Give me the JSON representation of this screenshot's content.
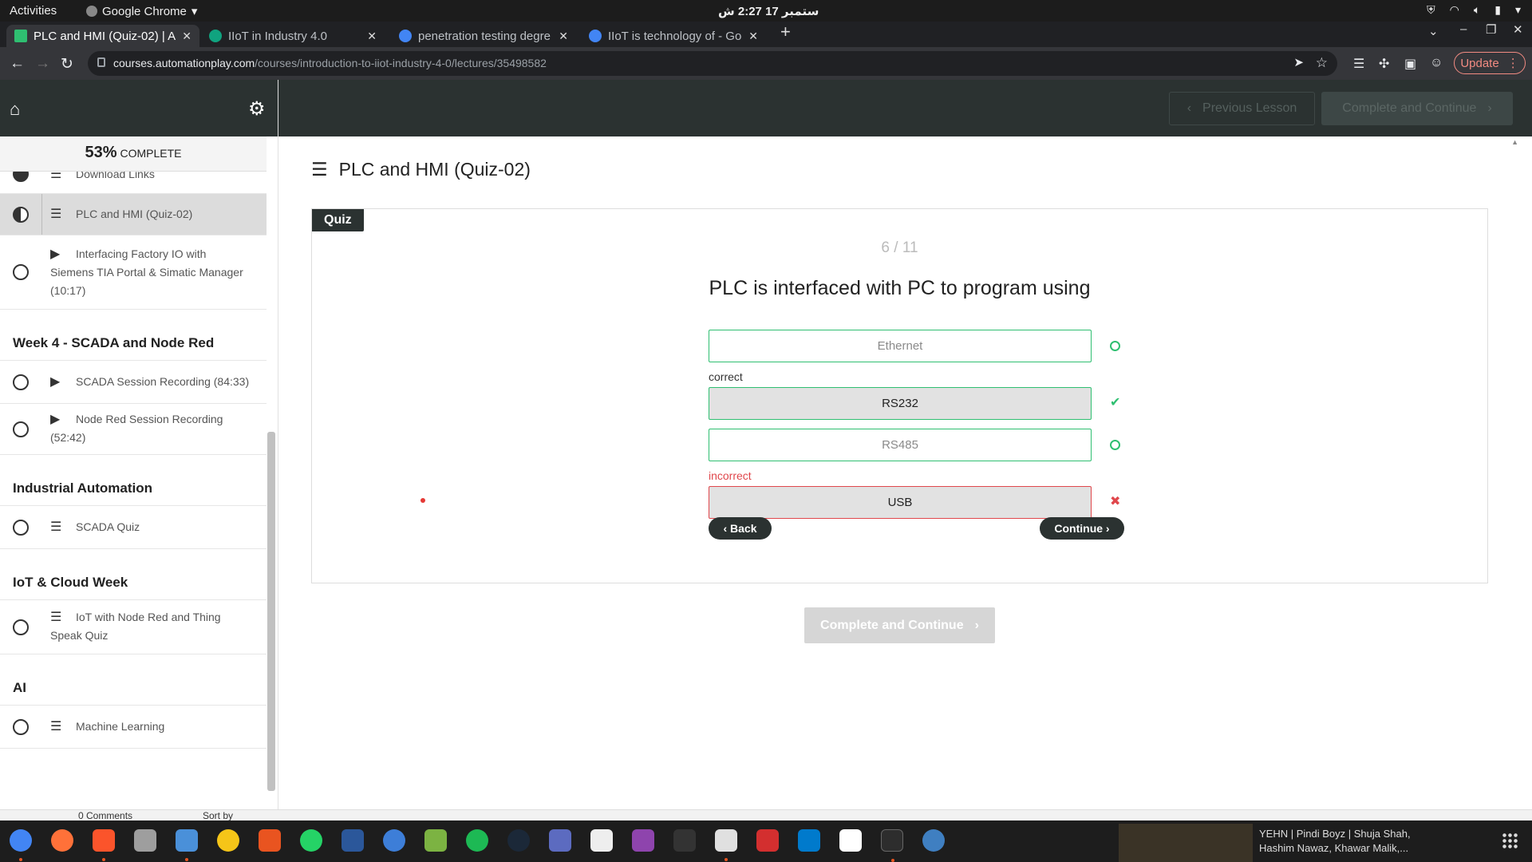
{
  "os": {
    "activities": "Activities",
    "app_menu": "Google Chrome",
    "clock": "ستمبر 17  2:27 ش"
  },
  "browser": {
    "tabs": [
      {
        "title": "PLC and HMI (Quiz-02) | A",
        "active": true,
        "favicon_color": "#2fbf71"
      },
      {
        "title": "IIoT in Industry 4.0",
        "active": false,
        "favicon_color": "#10a37f"
      },
      {
        "title": "penetration testing degre",
        "active": false,
        "favicon_color": "#4285f4"
      },
      {
        "title": "IIoT is technology of - Goo",
        "active": false,
        "favicon_color": "#4285f4"
      }
    ],
    "url_host": "courses.automationplay.com",
    "url_path": "/courses/introduction-to-iiot-industry-4-0/lectures/35498582",
    "update_label": "Update"
  },
  "header": {
    "prev_label": "Previous Lesson",
    "complete_label": "Complete and Continue"
  },
  "sidebar": {
    "progress_pct": "53%",
    "progress_text": "COMPLETE",
    "items": [
      {
        "label": "Download Links",
        "status": "done"
      },
      {
        "label": "PLC and HMI (Quiz-02)",
        "status": "half"
      },
      {
        "label": "Interfacing Factory IO with Siemens TIA Portal & Simatic Manager (10:17)",
        "status": "open"
      }
    ],
    "sections": [
      {
        "title": "Week 4 - SCADA and Node Red",
        "items": [
          {
            "label": "SCADA Session Recording (84:33)"
          },
          {
            "label": "Node Red Session Recording (52:42)"
          }
        ]
      },
      {
        "title": "Industrial Automation",
        "items": [
          {
            "label": "SCADA Quiz"
          }
        ]
      },
      {
        "title": "IoT & Cloud Week",
        "items": [
          {
            "label": "IoT with Node Red and Thing Speak Quiz"
          }
        ]
      },
      {
        "title": "AI",
        "items": [
          {
            "label": "Machine Learning"
          }
        ]
      }
    ]
  },
  "main": {
    "lesson_title": "PLC and HMI (Quiz-02)",
    "quiz_label": "Quiz",
    "counter": "6 / 11",
    "question": "PLC is interfaced with PC to program using",
    "answers": [
      {
        "text": "Ethernet",
        "state": "unselected"
      },
      {
        "text": "RS232",
        "state": "correct",
        "note": "correct"
      },
      {
        "text": "RS485",
        "state": "unselected"
      },
      {
        "text": "USB",
        "state": "incorrect",
        "note": "incorrect"
      }
    ],
    "back_label": "‹ Back",
    "continue_label": "Continue ›",
    "complete_label": "Complete and Continue"
  },
  "bottom": {
    "comments": "0 Comments",
    "sort": "Sort by"
  },
  "dock": {
    "media_line1": "YEHN | Pindi Boyz | Shuja Shah,",
    "media_line2": "Hashim Nawaz, Khawar Malik,..."
  },
  "colors": {
    "header_bg": "#2b3231",
    "correct": "#2fbf71",
    "incorrect": "#e0474c"
  }
}
